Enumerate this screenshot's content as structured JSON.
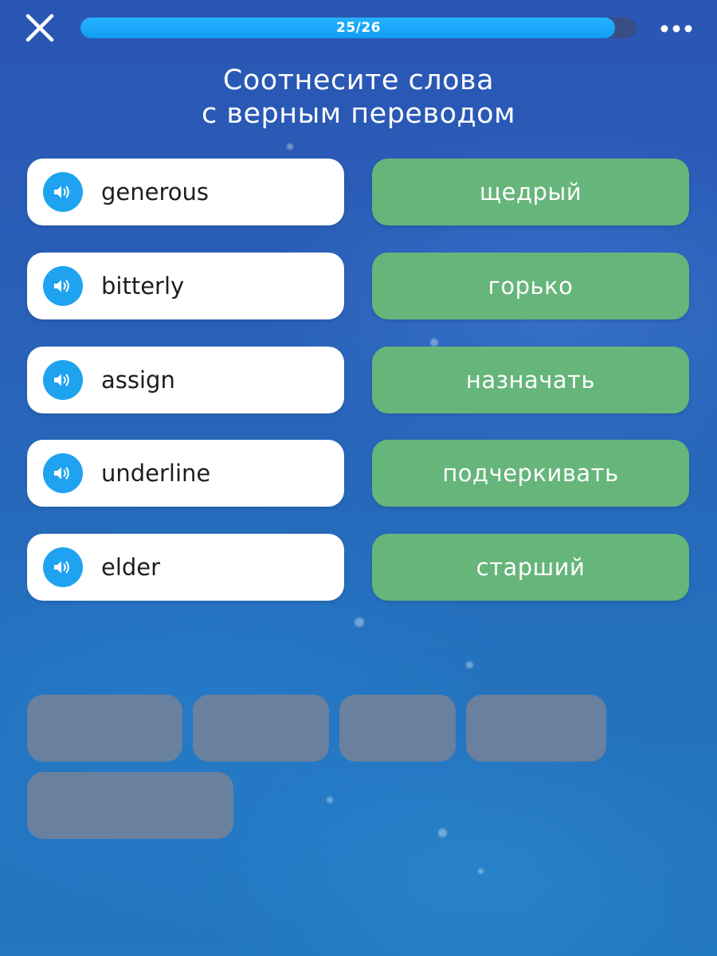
{
  "header": {
    "progress_text": "25/26",
    "progress_fraction": 0.962
  },
  "title": {
    "line1": "Соотнесите слова",
    "line2": "с верным переводом"
  },
  "pairs": [
    {
      "word": "generous",
      "translation": "щедрый"
    },
    {
      "word": "bitterly",
      "translation": "горько"
    },
    {
      "word": "assign",
      "translation": "назначать"
    },
    {
      "word": "underline",
      "translation": "подчеркивать"
    },
    {
      "word": "elder",
      "translation": "старший"
    }
  ],
  "icons": {
    "close": "close-icon",
    "more": "more-dots-icon",
    "speaker": "speaker-icon"
  },
  "colors": {
    "accent": "#1fa3f0",
    "correct": "#66b57a",
    "slot": "#6c809e"
  }
}
